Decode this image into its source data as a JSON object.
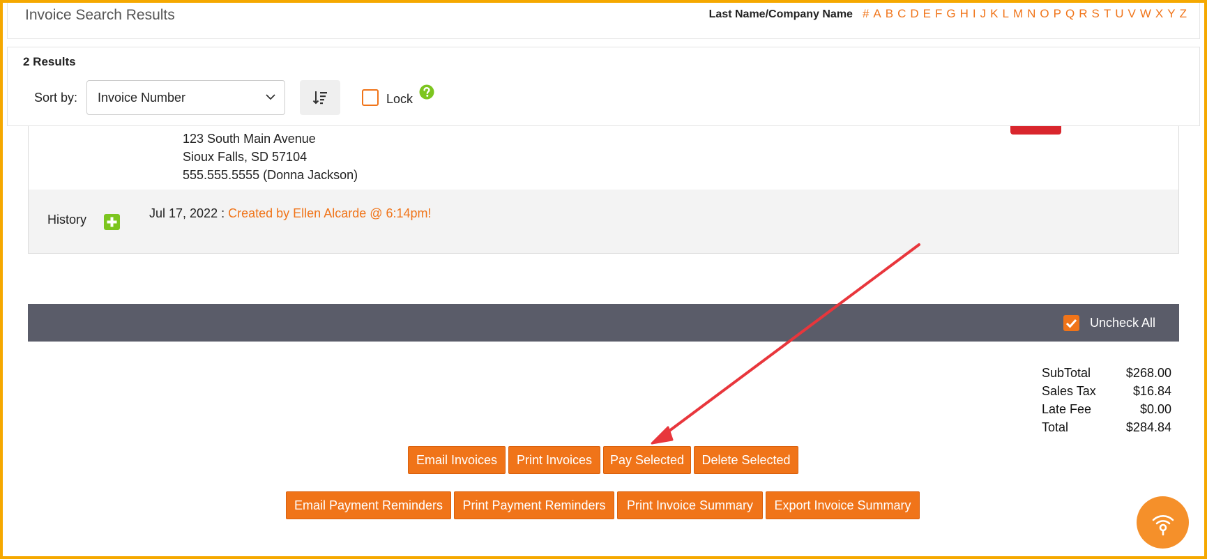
{
  "header": {
    "title": "Invoice Search Results",
    "alpha_label": "Last Name/Company Name",
    "letters": [
      "#",
      "A",
      "B",
      "C",
      "D",
      "E",
      "F",
      "G",
      "H",
      "I",
      "J",
      "K",
      "L",
      "M",
      "N",
      "O",
      "P",
      "Q",
      "R",
      "S",
      "T",
      "U",
      "V",
      "W",
      "X",
      "Y",
      "Z"
    ]
  },
  "results": {
    "count_text": "2 Results",
    "sort_label": "Sort by:",
    "sort_value": "Invoice Number",
    "lock_label": "Lock"
  },
  "invoice": {
    "address_line1": "123 South Main Avenue",
    "address_line2": "Sioux Falls, SD 57104",
    "phone": "555.555.5555 (Donna Jackson)",
    "history_label": "History",
    "history_date": "Jul 17, 2022 :",
    "history_text": "Created by Ellen Alcarde @ 6:14pm!"
  },
  "bulk": {
    "uncheck_label": "Uncheck All"
  },
  "totals": {
    "subtotal_label": "SubTotal",
    "subtotal": "$268.00",
    "tax_label": "Sales Tax",
    "tax": "$16.84",
    "late_label": "Late Fee",
    "late": "$0.00",
    "total_label": "Total",
    "total": "$284.84"
  },
  "buttons": {
    "email_invoices": "Email Invoices",
    "print_invoices": "Print Invoices",
    "pay_selected": "Pay Selected",
    "delete_selected": "Delete Selected",
    "email_reminders": "Email Payment Reminders",
    "print_reminders": "Print Payment Reminders",
    "print_summary": "Print Invoice Summary",
    "export_summary": "Export Invoice Summary"
  },
  "colors": {
    "accent": "#f07419",
    "frame": "#f5a800",
    "bar": "#5a5c69",
    "badge": "#d9262d",
    "help": "#7cc51f",
    "arrow": "#e8363c"
  },
  "icons": {
    "sort": "sort-order-icon",
    "help": "question-circle-icon",
    "add": "plus-square-icon",
    "check": "check-icon",
    "widget": "broadcast-icon"
  }
}
